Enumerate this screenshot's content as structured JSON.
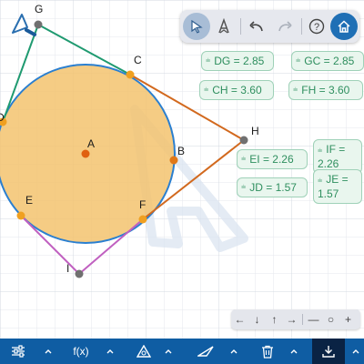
{
  "points": {
    "G": "G",
    "C": "C",
    "H": "H",
    "A": "A",
    "B": "B",
    "E": "E",
    "F": "F",
    "I": "I",
    "D": "D"
  },
  "measurements": {
    "dg": "DG = 2.85",
    "gc": "GC = 2.85",
    "ch": "CH = 3.60",
    "fh": "FH = 3.60",
    "ei": "EI = 2.26",
    "if": "IF = 2.26",
    "jd": "JD = 1.57",
    "je": "JE = 1.57"
  },
  "equal_symbol": "⩧",
  "toolbar": {
    "tools": [
      "select-arrow-icon",
      "label-style-icon",
      "undo-icon",
      "redo-icon",
      "help-icon",
      "home-icon"
    ]
  },
  "nav": {
    "left": "←",
    "down": "↓",
    "up": "↑",
    "right": "→",
    "minus": "—",
    "reset": "○",
    "plus": "+"
  },
  "bottombar": {
    "fx_label": "f(x)",
    "icons": [
      "sliders-icon",
      "function-icon",
      "triangle-icon",
      "measure-icon",
      "trash-icon",
      "export-icon"
    ]
  },
  "colors": {
    "circle_fill": "#f3c36f",
    "circle_stroke": "#2a7fd0",
    "segment_green": "#1f9a70",
    "segment_orange": "#d2691e",
    "segment_pink": "#c060c0",
    "point_orange": "#f0a020",
    "center_point": "#e06010",
    "bar_blue": "#0f5da3"
  }
}
